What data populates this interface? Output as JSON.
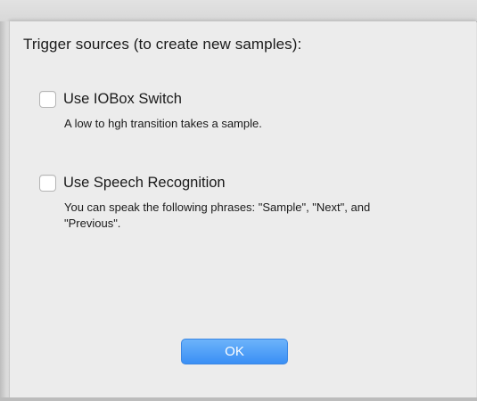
{
  "dialog": {
    "heading": "Trigger sources (to create new samples):",
    "options": [
      {
        "label": "Use IOBox Switch",
        "description": "A low to hgh transition takes a sample.",
        "checked": false
      },
      {
        "label": "Use Speech Recognition",
        "description": "You can speak the following phrases: \"Sample\", \"Next\", and \"Previous\".",
        "checked": false
      }
    ],
    "ok_label": "OK"
  },
  "colors": {
    "background": "#ececec",
    "button_blue": "#3a8ff5",
    "checkbox_border": "#b5b5b5"
  }
}
